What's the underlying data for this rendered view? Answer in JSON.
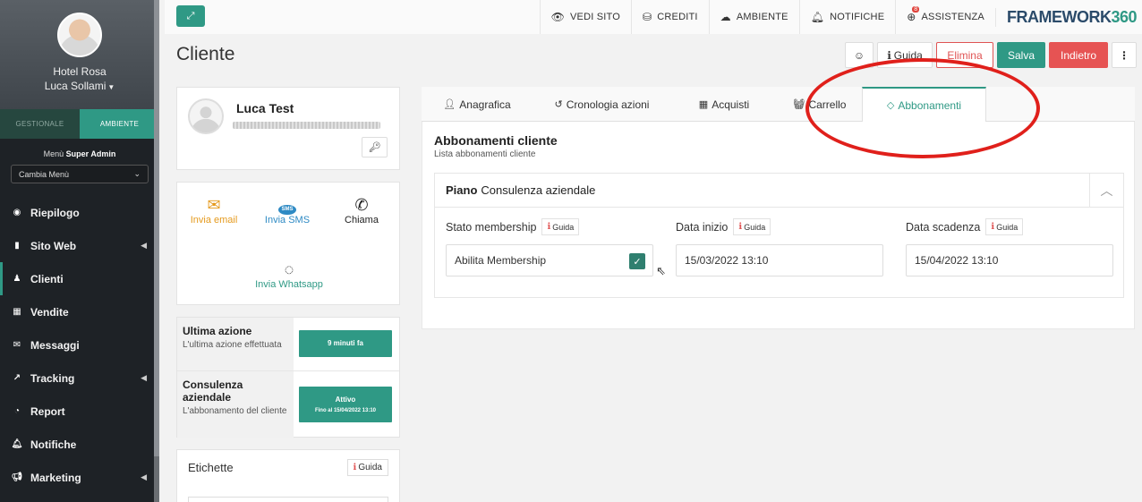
{
  "sidebar": {
    "hotel": "Hotel Rosa",
    "user": "Luca Sollami",
    "tabs": [
      "GESTIONALE",
      "AMBIENTE"
    ],
    "menu_prefix": "Menù",
    "menu_role": "Super Admin",
    "menu_select": "Cambia Menù",
    "items": [
      {
        "label": "Riepilogo",
        "icon": "dashboard-icon"
      },
      {
        "label": "Sito Web",
        "icon": "file-icon"
      },
      {
        "label": "Clienti",
        "icon": "user-icon"
      },
      {
        "label": "Vendite",
        "icon": "calculator-icon"
      },
      {
        "label": "Messaggi",
        "icon": "envelope-icon"
      },
      {
        "label": "Tracking",
        "icon": "chart-icon"
      },
      {
        "label": "Report",
        "icon": "pie-icon"
      },
      {
        "label": "Notifiche",
        "icon": "bell-icon"
      },
      {
        "label": "Marketing",
        "icon": "megaphone-icon"
      }
    ]
  },
  "topbar": {
    "vedi_sito": "VEDI SITO",
    "crediti": "CREDITI",
    "ambiente": "AMBIENTE",
    "notifiche": "NOTIFICHE",
    "assistenza": "ASSISTENZA",
    "assistenza_badge": "8",
    "logo_main": "FRAMEWORK",
    "logo_num": "360"
  },
  "header": {
    "title": "Cliente",
    "guida": "Guida",
    "elimina": "Elimina",
    "salva": "Salva",
    "indietro": "Indietro"
  },
  "contact": {
    "name": "Luca Test"
  },
  "actions": {
    "email": "Invia email",
    "sms": "Invia SMS",
    "sms_icon_text": "SMS",
    "chiama": "Chiama",
    "whatsapp": "Invia Whatsapp"
  },
  "info": {
    "last_action_title": "Ultima azione",
    "last_action_sub": "L'ultima azione effettuata",
    "last_action_value": "9 minuti fa",
    "plan_title": "Consulenza aziendale",
    "plan_sub": "L'abbonamento del cliente",
    "plan_status": "Attivo",
    "plan_until": "Fino al 15/04/2022 13:10"
  },
  "labels": {
    "title": "Etichette",
    "guida": "Guida"
  },
  "tabs": {
    "anagrafica": "Anagrafica",
    "cronologia": "Cronologia azioni",
    "acquisti": "Acquisti",
    "carrello": "Carrello",
    "abbonamenti": "Abbonamenti"
  },
  "panel": {
    "title": "Abbonamenti cliente",
    "subtitle": "Lista abbonamenti cliente",
    "plan_label": "Piano",
    "plan_name": "Consulenza aziendale",
    "guida": "Guida",
    "fields": {
      "stato_label": "Stato membership",
      "stato_value": "Abilita Membership",
      "inizio_label": "Data inizio",
      "inizio_value": "15/03/2022 13:10",
      "scadenza_label": "Data scadenza",
      "scadenza_value": "15/04/2022 13:10"
    }
  },
  "colors": {
    "accent": "#2f9985",
    "danger": "#e65353",
    "sidebar_bg": "#1e2226",
    "annotation": "#e0201b"
  }
}
